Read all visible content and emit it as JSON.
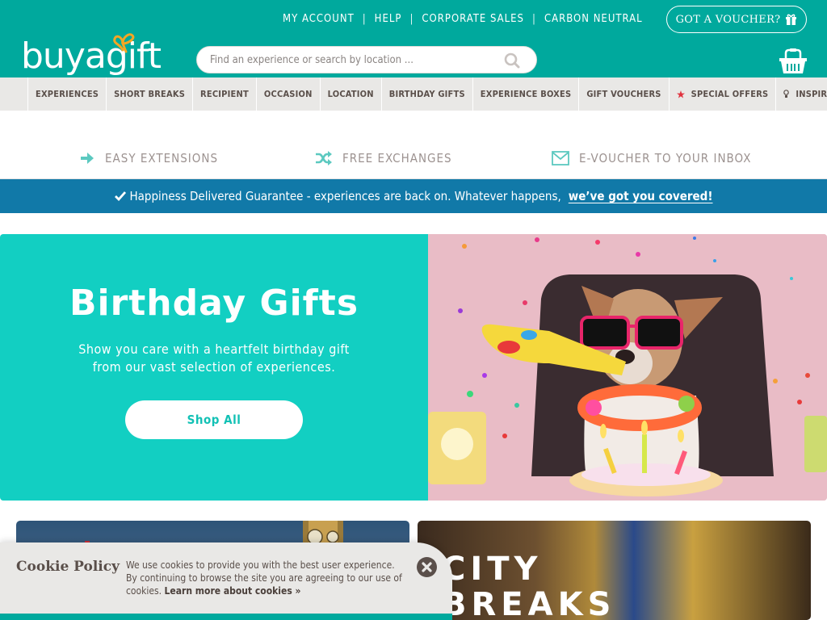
{
  "header": {
    "logo_text": "buyagift",
    "top_links": [
      "MY ACCOUNT",
      "HELP",
      "CORPORATE SALES",
      "CARBON NEUTRAL"
    ],
    "voucher_button": "GOT A VOUCHER?",
    "search_placeholder": "Find an experience or search by location ...",
    "brand_color": "#00a99d",
    "bow_color": "#f5a623"
  },
  "nav": {
    "items": [
      {
        "label": "EXPERIENCES"
      },
      {
        "label": "SHORT BREAKS"
      },
      {
        "label": "RECIPIENT"
      },
      {
        "label": "OCCASION"
      },
      {
        "label": "LOCATION"
      },
      {
        "label": "BIRTHDAY GIFTS"
      },
      {
        "label": "EXPERIENCE BOXES"
      },
      {
        "label": "GIFT VOUCHERS"
      },
      {
        "label": "SPECIAL OFFERS",
        "icon": "star-icon"
      },
      {
        "label": "INSPIRATION",
        "icon": "lightbulb-icon"
      }
    ]
  },
  "usps": [
    {
      "label": "EASY EXTENSIONS",
      "icon": "arrow-right-icon"
    },
    {
      "label": "FREE EXCHANGES",
      "icon": "shuffle-icon"
    },
    {
      "label": "E-VOUCHER TO YOUR INBOX",
      "icon": "envelope-icon"
    }
  ],
  "guarantee": {
    "text": "Happiness Delivered Guarantee - experiences are back on. Whatever happens,",
    "link": "we’ve got you covered!"
  },
  "hero": {
    "title": "Birthday Gifts",
    "subtitle_line1": "Show you care with a heartfelt birthday gift",
    "subtitle_line2": "from our vast selection of experiences.",
    "button": "Shop All"
  },
  "cards": [
    {
      "title": ""
    },
    {
      "title_line1": "CITY",
      "title_line2": "BREAKS"
    }
  ],
  "cookie": {
    "title": "Cookie Policy",
    "text": "We use cookies to provide you with the best user experience. By continuing to browse the site you are agreeing to our use of cookies.",
    "link": "Learn more about cookies »"
  }
}
